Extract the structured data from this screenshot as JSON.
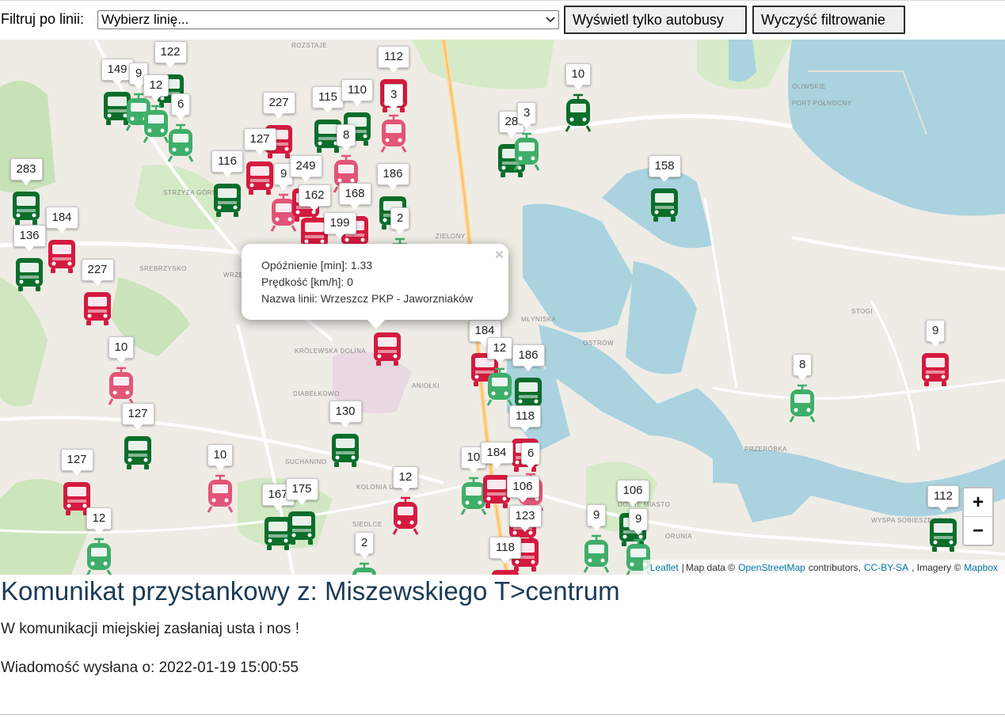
{
  "filter": {
    "label": "Filtruj po linii:",
    "select_value": "Wybierz linię...",
    "buses_button": "Wyświetl tylko autobusy",
    "clear_button": "Wyczyść filtrowanie"
  },
  "map": {
    "colors": {
      "bus_green": "#0b6e2b",
      "tram_green": "#3fae6a",
      "bus_red": "#d41a3f",
      "tram_red": "#e25577",
      "water": "#aad3df",
      "land": "#efece6"
    },
    "place_labels": [
      "OLIWSKIE",
      "PORT PÓŁNOCNY",
      "MŁYNISKA",
      "OSTRÓW",
      "STOGI",
      "SIEDLCE",
      "SUCHANINO",
      "ORUNIA",
      "DOLNE MIASTO",
      "WRZESZCZ",
      "ROZSTAJE",
      "PRZERÓBKA",
      "STRZYŻA GÓRNA",
      "SREBRZYSKO",
      "KRÓLEWSKA DOLINA",
      "ZIELONY",
      "WYSPA SOBIESZEWSKA",
      "ANIOŁKI",
      "DIABEŁKOWO",
      "KOLONIA UROCZA"
    ],
    "vehicles": [
      {
        "label": "149",
        "kind": "bus",
        "color": "bus_green"
      },
      {
        "label": "9",
        "kind": "tram",
        "color": "tram_green"
      },
      {
        "label": "122",
        "kind": "bus",
        "color": "bus_green"
      },
      {
        "label": "12",
        "kind": "tram",
        "color": "tram_green"
      },
      {
        "label": "6",
        "kind": "tram",
        "color": "tram_green"
      },
      {
        "label": "227",
        "kind": "bus",
        "color": "bus_red"
      },
      {
        "label": "112",
        "kind": "bus",
        "color": "bus_red"
      },
      {
        "label": "115",
        "kind": "bus",
        "color": "bus_green"
      },
      {
        "label": "110",
        "kind": "bus",
        "color": "bus_green"
      },
      {
        "label": "3",
        "kind": "tram",
        "color": "tram_red"
      },
      {
        "label": "10",
        "kind": "tram",
        "color": "bus_green"
      },
      {
        "label": "28",
        "kind": "bus",
        "color": "bus_green"
      },
      {
        "label": "3",
        "kind": "tram",
        "color": "tram_green"
      },
      {
        "label": "8",
        "kind": "tram",
        "color": "tram_red"
      },
      {
        "label": "127",
        "kind": "bus",
        "color": "bus_red"
      },
      {
        "label": "116",
        "kind": "bus",
        "color": "bus_green"
      },
      {
        "label": "9",
        "kind": "tram",
        "color": "tram_red"
      },
      {
        "label": "249",
        "kind": "bus",
        "color": "bus_red"
      },
      {
        "label": "162",
        "kind": "bus",
        "color": "bus_red"
      },
      {
        "label": "168",
        "kind": "bus",
        "color": "bus_red"
      },
      {
        "label": "186",
        "kind": "bus",
        "color": "bus_green"
      },
      {
        "label": "199",
        "kind": "bus",
        "color": "bus_red"
      },
      {
        "label": "2",
        "kind": "tram",
        "color": "tram_green"
      },
      {
        "label": "158",
        "kind": "bus",
        "color": "bus_green"
      },
      {
        "label": "283",
        "kind": "bus",
        "color": "bus_green"
      },
      {
        "label": "184",
        "kind": "bus",
        "color": "bus_red"
      },
      {
        "label": "136",
        "kind": "bus",
        "color": "bus_green"
      },
      {
        "label": "227",
        "kind": "bus",
        "color": "bus_red"
      },
      {
        "label": "184",
        "kind": "bus",
        "color": "bus_red"
      },
      {
        "label": "12",
        "kind": "tram",
        "color": "tram_green"
      },
      {
        "label": "186",
        "kind": "bus",
        "color": "bus_green"
      },
      {
        "label": "9",
        "kind": "bus",
        "color": "bus_red"
      },
      {
        "label": "8",
        "kind": "tram",
        "color": "tram_green"
      },
      {
        "label": "10",
        "kind": "tram",
        "color": "tram_red"
      },
      {
        "label": "127",
        "kind": "bus",
        "color": "bus_green"
      },
      {
        "label": "130",
        "kind": "bus",
        "color": "bus_green"
      },
      {
        "label": "118",
        "kind": "bus",
        "color": "bus_red"
      },
      {
        "label": "127",
        "kind": "bus",
        "color": "bus_red"
      },
      {
        "label": "10",
        "kind": "tram",
        "color": "tram_red"
      },
      {
        "label": "12",
        "kind": "tram",
        "color": "bus_red"
      },
      {
        "label": "10",
        "kind": "tram",
        "color": "tram_green"
      },
      {
        "label": "184",
        "kind": "bus",
        "color": "bus_red"
      },
      {
        "label": "6",
        "kind": "tram",
        "color": "tram_red"
      },
      {
        "label": "106",
        "kind": "bus",
        "color": "bus_red"
      },
      {
        "label": "167",
        "kind": "bus",
        "color": "bus_green"
      },
      {
        "label": "175",
        "kind": "bus",
        "color": "bus_green"
      },
      {
        "label": "12",
        "kind": "tram",
        "color": "tram_green"
      },
      {
        "label": "123",
        "kind": "bus",
        "color": "bus_red"
      },
      {
        "label": "106",
        "kind": "bus",
        "color": "bus_green"
      },
      {
        "label": "9",
        "kind": "tram",
        "color": "tram_green"
      },
      {
        "label": "9",
        "kind": "tram",
        "color": "tram_green"
      },
      {
        "label": "2",
        "kind": "tram",
        "color": "tram_green"
      },
      {
        "label": "118",
        "kind": "bus",
        "color": "bus_red"
      },
      {
        "label": "112",
        "kind": "bus",
        "color": "bus_green"
      }
    ],
    "popup": {
      "delay": "Opóźnienie [min]: 1.33",
      "speed": "Prędkość [km/h]: 0",
      "line_name": "Nazwa linii: Wrzeszcz PKP - Jaworzniaków",
      "close": "×"
    },
    "zoom_in": "+",
    "zoom_out": "−",
    "attribution": {
      "leaflet": "Leaflet",
      "sep": "|",
      "map_data": "Map data ©",
      "osm": "OpenStreetMap",
      "contributors": "contributors,",
      "license": "CC-BY-SA",
      "imagery": ", Imagery ©",
      "mapbox": "Mapbox"
    }
  },
  "message": {
    "title": "Komunikat przystankowy z: Miszewskiego T>centrum",
    "text": "W komunikacji miejskiej zasłaniaj usta i nos !",
    "sent_at": "Wiadomość wysłana o: 2022-01-19 15:00:55"
  }
}
